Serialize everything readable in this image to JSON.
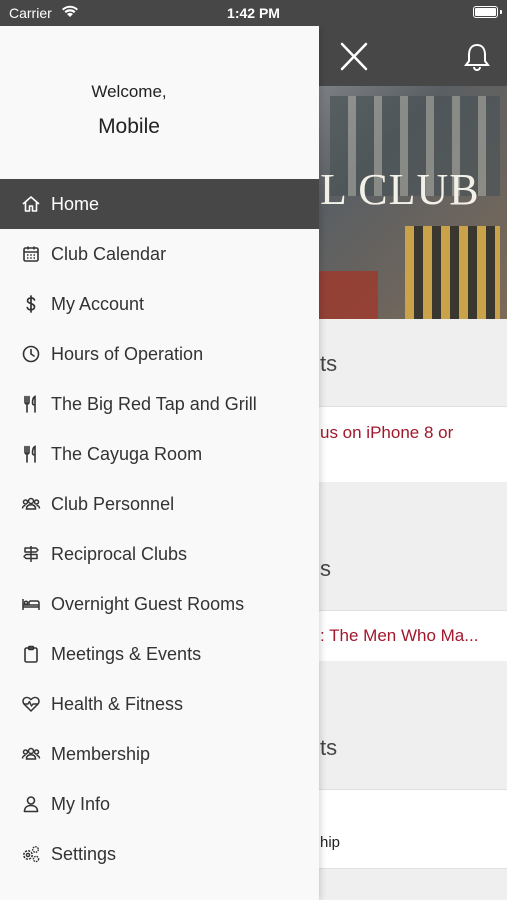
{
  "status_bar": {
    "carrier": "Carrier",
    "time": "1:42 PM"
  },
  "drawer": {
    "welcome": "Welcome,",
    "username": "Mobile",
    "items": [
      {
        "label": "Home",
        "icon": "home-icon",
        "active": true
      },
      {
        "label": "Club Calendar",
        "icon": "calendar-icon"
      },
      {
        "label": "My Account",
        "icon": "dollar-icon"
      },
      {
        "label": "Hours of Operation",
        "icon": "clock-icon"
      },
      {
        "label": "The Big Red Tap and Grill",
        "icon": "utensils-icon"
      },
      {
        "label": "The Cayuga Room",
        "icon": "utensils-icon"
      },
      {
        "label": "Club Personnel",
        "icon": "people-icon"
      },
      {
        "label": "Reciprocal Clubs",
        "icon": "signpost-icon"
      },
      {
        "label": "Overnight Guest Rooms",
        "icon": "bed-icon"
      },
      {
        "label": "Meetings & Events",
        "icon": "clipboard-icon"
      },
      {
        "label": "Health & Fitness",
        "icon": "heartbeat-icon"
      },
      {
        "label": "Membership",
        "icon": "people-icon"
      },
      {
        "label": "My Info",
        "icon": "user-icon"
      },
      {
        "label": "Settings",
        "icon": "gears-icon"
      }
    ]
  },
  "background": {
    "hero_text": "L CLUB",
    "section1": "ts",
    "card1": "us on iPhone 8 or",
    "section2": "s",
    "card2": ": The Men Who Ma...",
    "section3": "ts",
    "card3": "hip"
  },
  "colors": {
    "dark_bar": "#474747",
    "accent": "#a0182c",
    "drawer_bg": "#f9f9f9"
  }
}
